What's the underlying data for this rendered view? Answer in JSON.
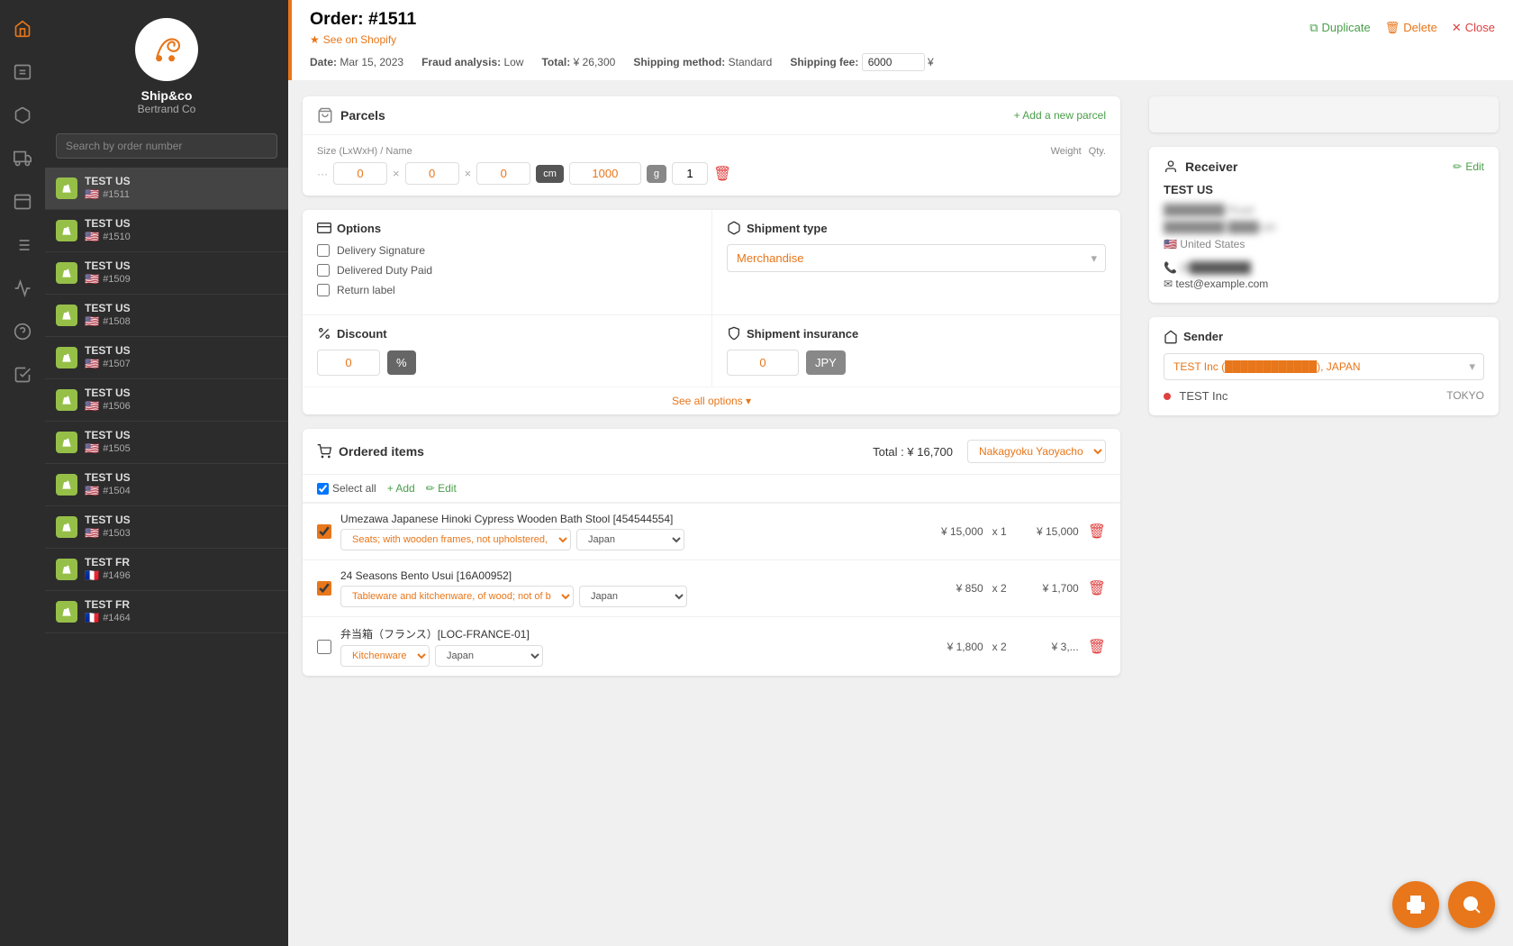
{
  "app": {
    "company": "Ship&co",
    "user": "Bertrand Co"
  },
  "sidebar": {
    "search_placeholder": "Search by order number",
    "orders": [
      {
        "id": 1,
        "name": "TEST US",
        "number": "#1511",
        "flag": "🇺🇸",
        "active": true
      },
      {
        "id": 2,
        "name": "TEST US",
        "number": "#1510",
        "flag": "🇺🇸",
        "active": false
      },
      {
        "id": 3,
        "name": "TEST US",
        "number": "#1509",
        "flag": "🇺🇸",
        "active": false
      },
      {
        "id": 4,
        "name": "TEST US",
        "number": "#1508",
        "flag": "🇺🇸",
        "active": false
      },
      {
        "id": 5,
        "name": "TEST US",
        "number": "#1507",
        "flag": "🇺🇸",
        "active": false
      },
      {
        "id": 6,
        "name": "TEST US",
        "number": "#1506",
        "flag": "🇺🇸",
        "active": false
      },
      {
        "id": 7,
        "name": "TEST US",
        "number": "#1505",
        "flag": "🇺🇸",
        "active": false
      },
      {
        "id": 8,
        "name": "TEST US",
        "number": "#1504",
        "flag": "🇺🇸",
        "active": false
      },
      {
        "id": 9,
        "name": "TEST US",
        "number": "#1503",
        "flag": "🇺🇸",
        "active": false
      },
      {
        "id": 10,
        "name": "TEST FR",
        "number": "#1496",
        "flag": "🇫🇷",
        "active": false
      },
      {
        "id": 11,
        "name": "TEST FR",
        "number": "#1464",
        "flag": "🇫🇷",
        "active": false
      }
    ]
  },
  "order": {
    "number": "#1511",
    "date": "Mar 15, 2023",
    "fraud": "Low",
    "total": "¥ 26,300",
    "shipping_method": "Standard",
    "shipping_fee": "6000",
    "currency": "¥"
  },
  "header_actions": {
    "duplicate": "Duplicate",
    "delete": "Delete",
    "close": "Close",
    "see_on_shopify": "See on Shopify"
  },
  "parcels": {
    "title": "Parcels",
    "add_label": "+ Add a new parcel",
    "col_size": "Size (LxWxH) / Name",
    "col_weight": "Weight",
    "col_qty": "Qty.",
    "dim_x": "0",
    "dim_y": "0",
    "dim_z": "0",
    "unit": "cm",
    "weight": "1000",
    "weight_unit": "g",
    "qty": "1"
  },
  "options": {
    "title": "Options",
    "delivery_signature": "Delivery Signature",
    "delivered_duty_paid": "Delivered Duty Paid",
    "return_label": "Return label",
    "discount_title": "Discount",
    "discount_value": "0",
    "discount_unit": "%",
    "shipment_type_title": "Shipment type",
    "shipment_type_value": "Merchandise",
    "shipment_insurance_title": "Shipment insurance",
    "insurance_value": "0",
    "insurance_unit": "JPY",
    "see_all_options": "See all options ▾"
  },
  "ordered_items": {
    "title": "Ordered items",
    "total_label": "Total : ¥ 16,700",
    "select_all": "Select all",
    "add": "+ Add",
    "edit": "✏ Edit",
    "location": "Nakagyoku Yaoyacho",
    "items": [
      {
        "checked": true,
        "name": "Umezawa Japanese Hinoki Cypress Wooden Bath Stool [454544554]",
        "category": "Seats; with wooden frames, not upholstered,",
        "country": "Japan",
        "unit_price": "¥ 15,000",
        "qty": "x 1",
        "total": "¥ 15,000"
      },
      {
        "checked": true,
        "name": "24 Seasons Bento Usui [16A00952]",
        "category": "Tableware and kitchenware, of wood; not of b",
        "country": "Japan",
        "unit_price": "¥ 850",
        "qty": "x 2",
        "total": "¥ 1,700"
      },
      {
        "checked": false,
        "name": "弁当箱（フランス）[LOC-FRANCE-01]",
        "category": "Kitchenware",
        "country": "Japan",
        "unit_price": "¥ 1,800",
        "qty": "x 2",
        "total": "¥ 3,..."
      }
    ]
  },
  "receiver": {
    "title": "Receiver",
    "edit_label": "Edit",
    "company": "TEST US",
    "address_line1": "████████ Road",
    "address_line2": "████████ ████cah",
    "country": "United States",
    "phone": "(9████████",
    "email": "test@example.com"
  },
  "sender": {
    "title": "Sender",
    "selected": "TEST Inc (████████████), JAPAN",
    "name": "TEST Inc",
    "location": "TOKYO"
  }
}
